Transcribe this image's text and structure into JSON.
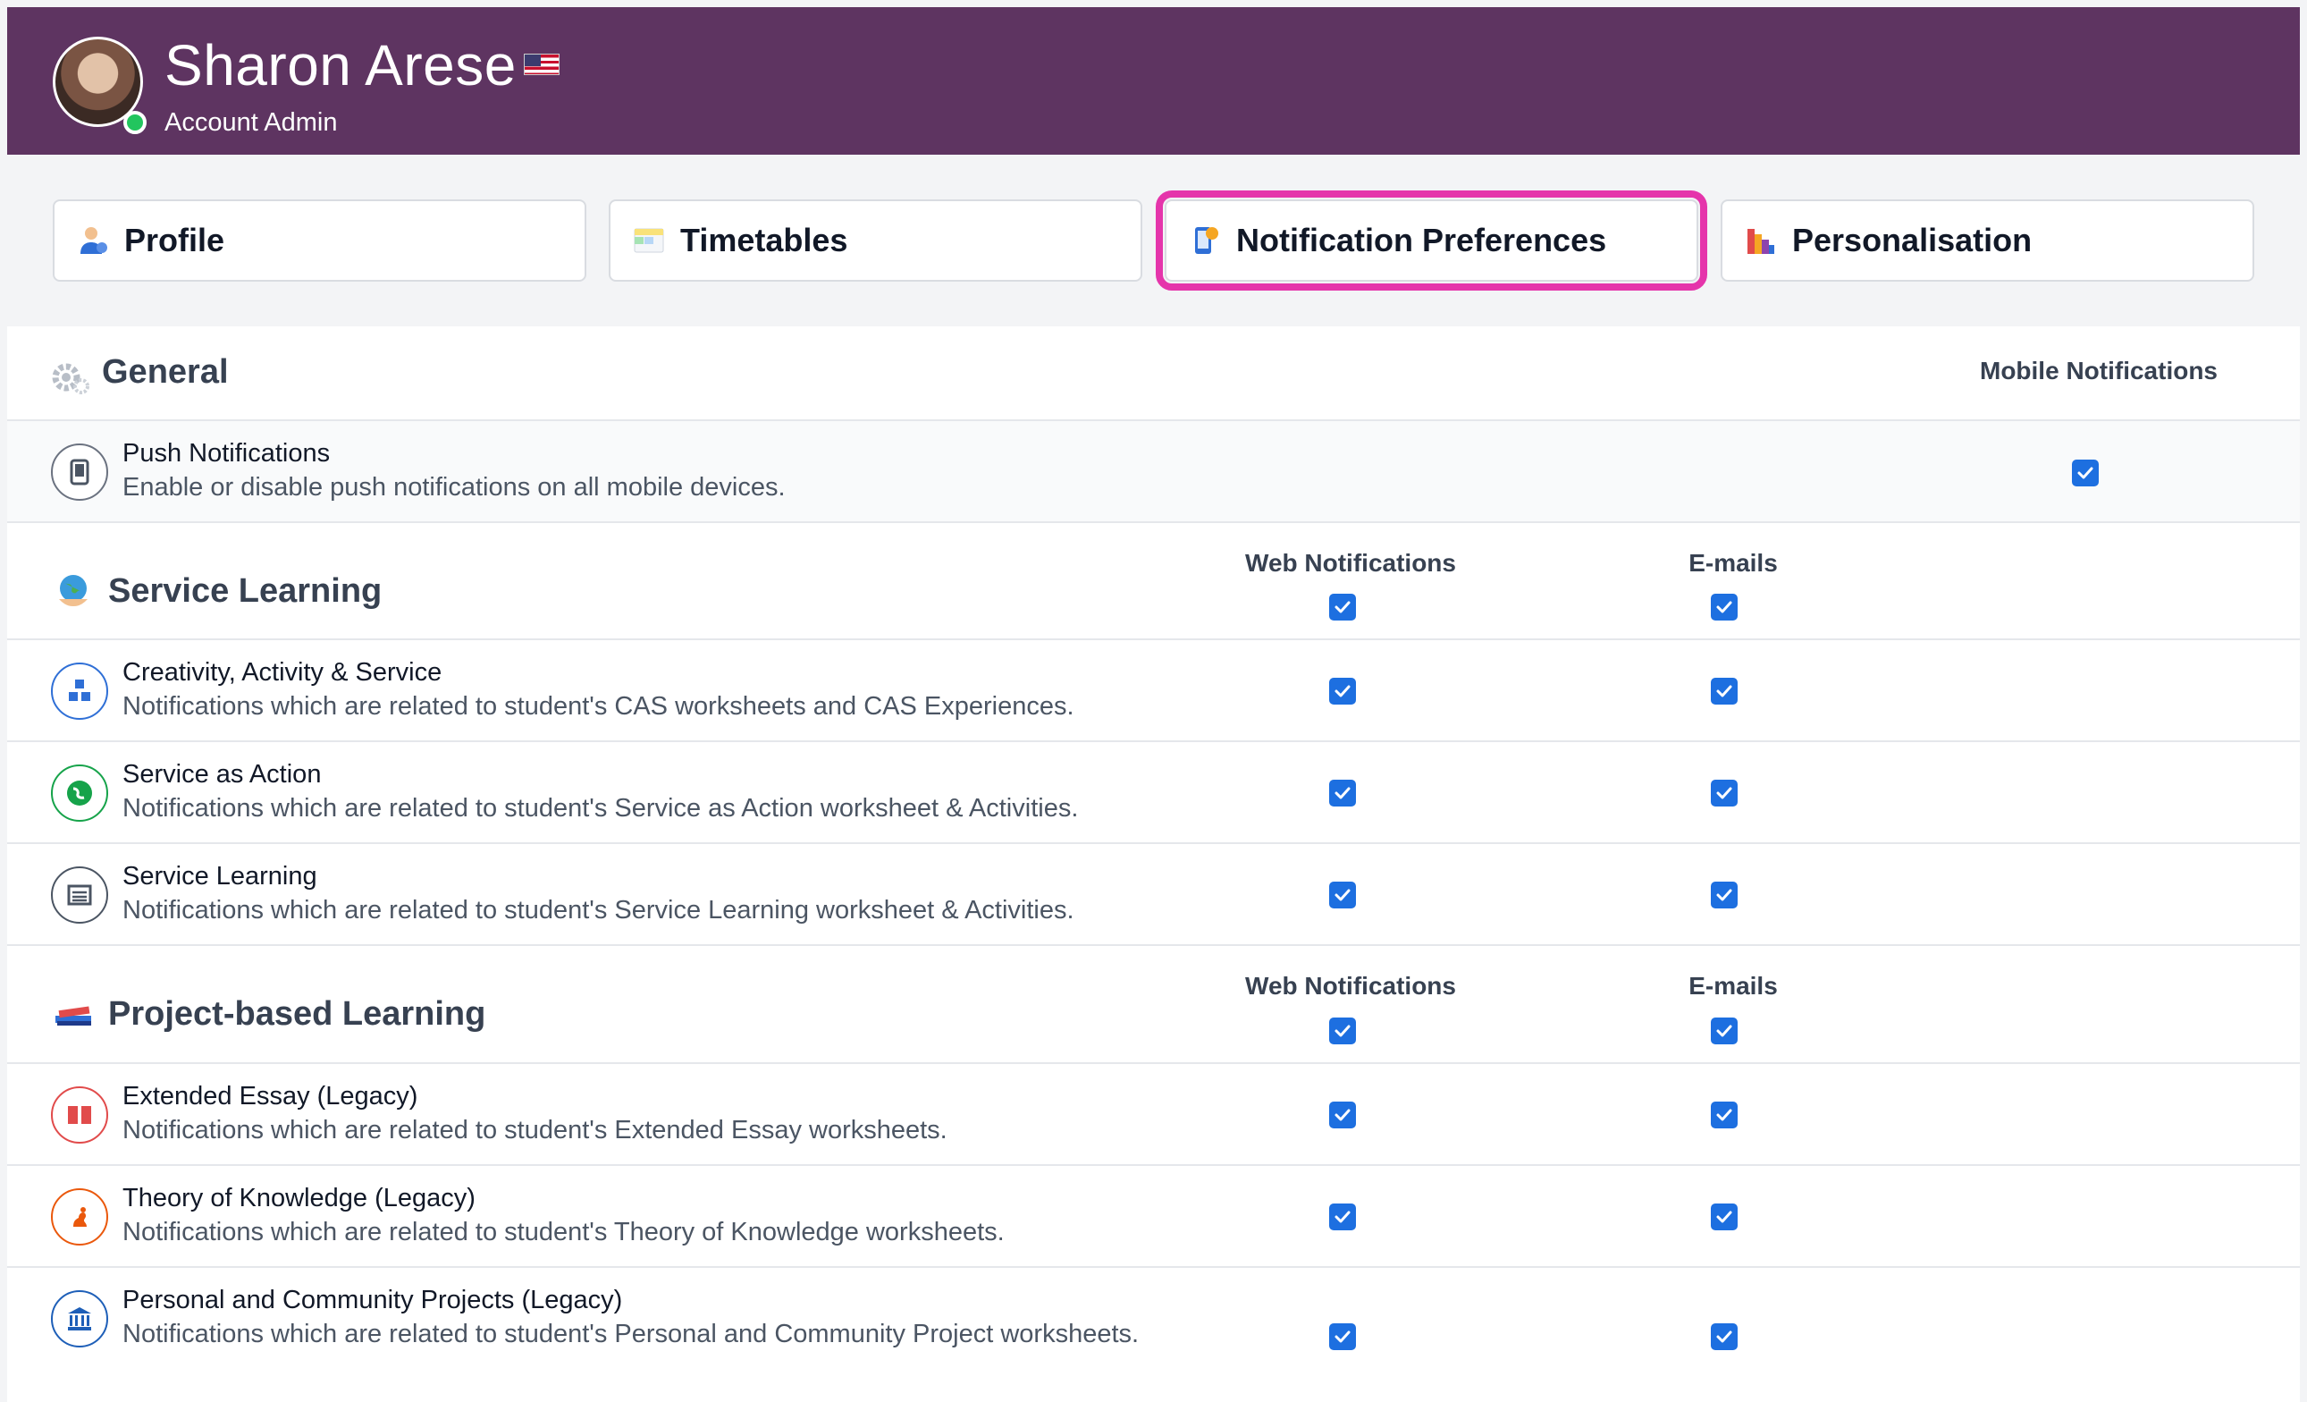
{
  "user": {
    "name": "Sharon Arese",
    "role": "Account Admin"
  },
  "tabs": [
    {
      "label": "Profile",
      "icon": "user-icon"
    },
    {
      "label": "Timetables",
      "icon": "calendar-icon"
    },
    {
      "label": "Notification Preferences",
      "icon": "phone-notification-icon",
      "highlighted": true
    },
    {
      "label": "Personalisation",
      "icon": "palette-icon"
    }
  ],
  "general": {
    "title": "General",
    "column": "Mobile Notifications",
    "rows": [
      {
        "title": "Push Notifications",
        "desc": "Enable or disable push notifications on all mobile devices.",
        "mobile": true
      }
    ]
  },
  "service": {
    "title": "Service Learning",
    "col_web": "Web Notifications",
    "col_email": "E-mails",
    "rows": [
      {
        "title": "Creativity, Activity & Service",
        "desc": "Notifications which are related to student's CAS worksheets and CAS Experiences."
      },
      {
        "title": "Service as Action",
        "desc": "Notifications which are related to student's Service as Action worksheet & Activities."
      },
      {
        "title": "Service Learning",
        "desc": "Notifications which are related to student's Service Learning worksheet & Activities."
      }
    ]
  },
  "project": {
    "title": "Project-based Learning",
    "col_web": "Web Notifications",
    "col_email": "E-mails",
    "rows": [
      {
        "title": "Extended Essay (Legacy)",
        "desc": "Notifications which are related to student's Extended Essay worksheets."
      },
      {
        "title": "Theory of Knowledge (Legacy)",
        "desc": "Notifications which are related to student's Theory of Knowledge worksheets."
      },
      {
        "title": "Personal and Community Projects (Legacy)",
        "desc": "Notifications which are related to student's Personal and Community Project worksheets."
      }
    ]
  },
  "colors": {
    "header_bg": "#5e3461",
    "checkbox": "#1d6fe0",
    "highlight": "#e535ab"
  }
}
